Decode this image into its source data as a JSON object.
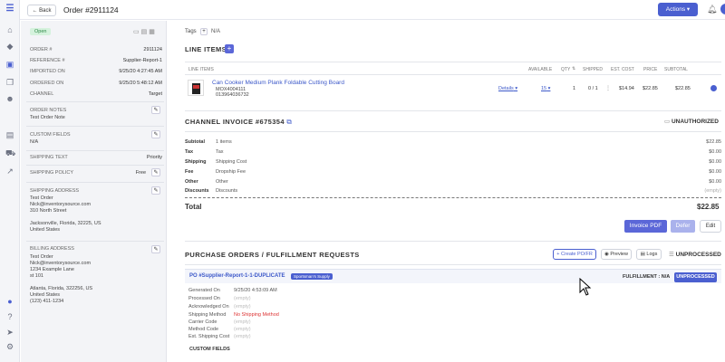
{
  "topbar": {
    "back_label": "Back",
    "order_title": "Order #2911124",
    "actions_label": "Actions"
  },
  "sidebar": {
    "status_badge": "Open",
    "fields": [
      {
        "label": "ORDER #",
        "value": "2911124"
      },
      {
        "label": "REFERENCE #",
        "value": "Supplier-Report-1"
      },
      {
        "label": "IMPORTED ON",
        "value": "9/25/20 4:27:45 AM"
      },
      {
        "label": "ORDERED ON",
        "value": "9/25/20 5:48:12 AM"
      },
      {
        "label": "CHANNEL",
        "value": "Target"
      }
    ],
    "order_notes_label": "ORDER NOTES",
    "order_notes_value": "Test Order Note",
    "custom_fields_label": "CUSTOM FIELDS",
    "custom_fields_value": "N/A",
    "shipping_text_label": "SHIPPING TEXT",
    "shipping_text_value": "Priority",
    "shipping_policy_label": "SHIPPING POLICY",
    "shipping_policy_value": "Free",
    "shipping_address_label": "SHIPPING ADDRESS",
    "shipping_address": [
      "Test Order",
      "Nick@inventorysource.com",
      "310 North Street",
      "",
      "Jacksonville, Florida, 32225, US",
      "United States"
    ],
    "billing_address_label": "BILLING ADDRESS",
    "billing_address": [
      "Test Order",
      "Nick@inventorysource.com",
      "1234 Example Lane",
      "st 101",
      "",
      "Atlanta, Florida, 322256, US",
      "United States",
      "(123) 411-1234"
    ]
  },
  "tags": {
    "label": "Tags",
    "add": "+",
    "value": "N/A"
  },
  "line_items": {
    "title": "LINE ITEMS",
    "add_label": "+",
    "headers": [
      "LINE ITEMS",
      "AVAILABLE",
      "QTY",
      "SHIPPED",
      "EST. COST",
      "PRICE",
      "SUBTOTAL"
    ],
    "item": {
      "name": "Can Cooker Medium Plank Foldable Cutting Board",
      "sku": "MOX4004111",
      "upc": "013964036732",
      "details": "Details",
      "available": "15",
      "qty": "1",
      "shipped": "0 / 1",
      "est_cost": "$14.94",
      "price": "$22.85",
      "subtotal": "$22.85"
    }
  },
  "invoice": {
    "title": "CHANNEL INVOICE #675354",
    "status": "UNAUTHORIZED",
    "rows": [
      {
        "label": "Subtotal",
        "desc": "1 items",
        "value": "$22.85"
      },
      {
        "label": "Tax",
        "desc": "Tax",
        "value": "$0.00"
      },
      {
        "label": "Shipping",
        "desc": "Shipping Cost",
        "value": "$0.00"
      },
      {
        "label": "Fee",
        "desc": "Dropship Fee",
        "value": "$0.00"
      },
      {
        "label": "Other",
        "desc": "Other",
        "value": "$0.00"
      },
      {
        "label": "Discounts",
        "desc": "Discounts",
        "value": "(empty)"
      }
    ],
    "total_label": "Total",
    "total_value": "$22.85",
    "invoice_pdf": "Invoice PDF",
    "defer": "Defer",
    "edit": "Edit"
  },
  "purchase_orders": {
    "title": "PURCHASE ORDERS / FULFILLMENT REQUESTS",
    "create_label": "Create PO/FR",
    "preview_label": "Preview",
    "logs_label": "Logs",
    "status": "UNPROCESSED",
    "po_title": "PO #Supplier-Report-1-1-DUPLICATE",
    "supplier_badge": "Sportsman's Supply",
    "fulfillment": "FULFILLMENT : N/A",
    "po_status": "UNPROCESSED",
    "rows": [
      {
        "label": "Generated On",
        "value": "9/25/20 4:53:09 AM"
      },
      {
        "label": "Processed On",
        "value": "(empty)"
      },
      {
        "label": "Acknowledged On",
        "value": "(empty)"
      },
      {
        "label": "Shipping Method",
        "value": "No Shipping Method"
      },
      {
        "label": "Carrier Code",
        "value": "(empty)"
      },
      {
        "label": "Method Code",
        "value": "(empty)"
      },
      {
        "label": "Est. Shipping Cost",
        "value": "(empty)"
      }
    ],
    "custom_fields_label": "CUSTOM FIELDS"
  },
  "colors": {
    "accent": "#4a5fd0",
    "open_badge": "#d5f2dd",
    "purple_btn": "#5b67d8"
  }
}
